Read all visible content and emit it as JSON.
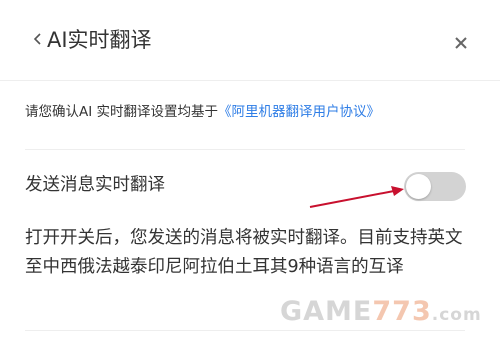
{
  "header": {
    "back_icon": "chevron-left-icon",
    "title": "AI实时翻译",
    "close_icon": "close-icon"
  },
  "notice": {
    "text": "请您确认AI 实时翻译设置均基于",
    "link": "《阿里机器翻译用户协议》",
    "link_color": "#2e7de6"
  },
  "setting": {
    "label": "发送消息实时翻译",
    "toggle_on": false,
    "toggle_off_color": "#d3d3d3"
  },
  "description": {
    "text": "打开开关后，您发送的消息将被实时翻译。目前支持英文至中西俄法越泰印尼阿拉伯土耳其9种语言的互译"
  },
  "annotation": {
    "arrow_color": "#c8102e"
  },
  "watermark": {
    "prefix": "GAME",
    "accent": "773",
    "suffix": ".com"
  }
}
